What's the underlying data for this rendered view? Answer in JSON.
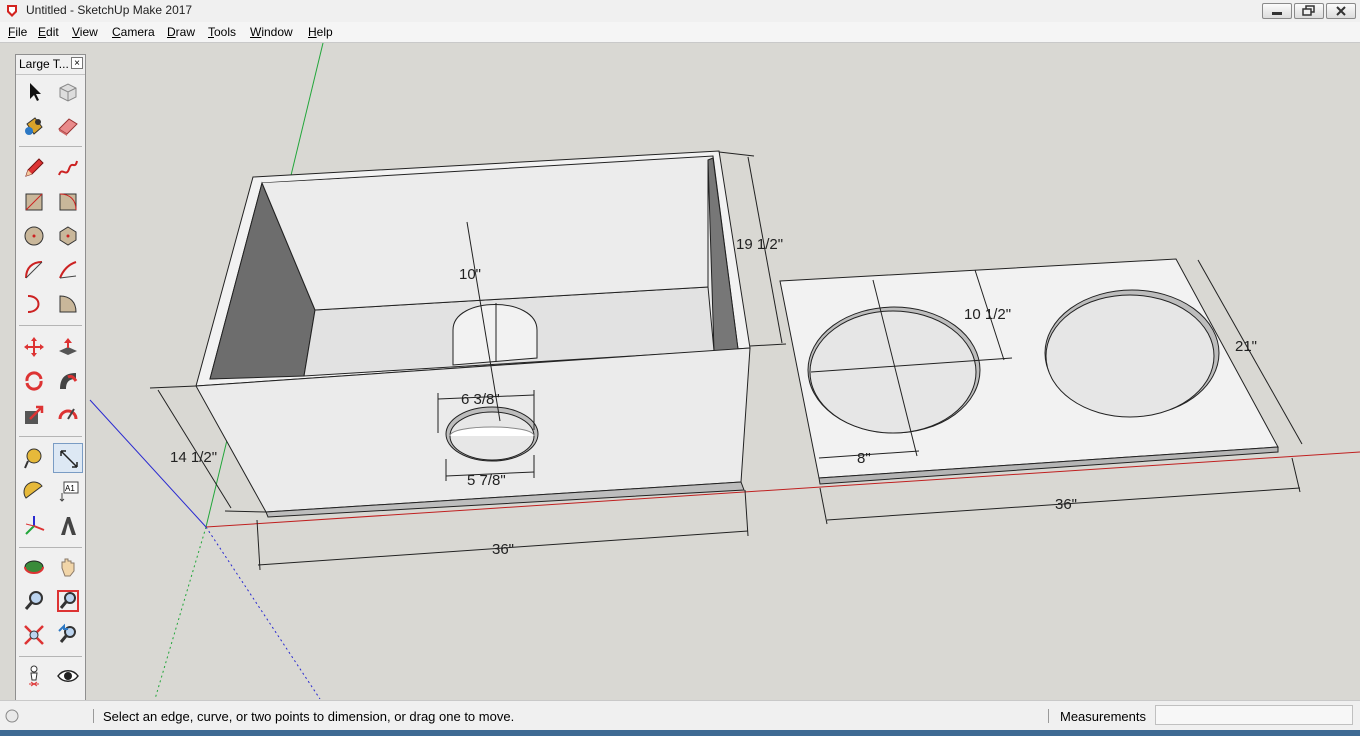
{
  "window": {
    "title": "Untitled - SketchUp Make 2017"
  },
  "menu": [
    "File",
    "Edit",
    "View",
    "Camera",
    "Draw",
    "Tools",
    "Window",
    "Help"
  ],
  "toolbar": {
    "title": "Large T...",
    "close_glyph": "×",
    "text_tool_glyph": "A1"
  },
  "tools": [
    {
      "name": "select-tool",
      "icon": "arrow-icon"
    },
    {
      "name": "make-component-tool",
      "icon": "component-icon"
    },
    {
      "name": "paint-bucket-tool",
      "icon": "paint-bucket-icon"
    },
    {
      "name": "eraser-tool",
      "icon": "eraser-icon"
    },
    {
      "name": "line-tool",
      "icon": "pencil-icon"
    },
    {
      "name": "freehand-tool",
      "icon": "freehand-icon"
    },
    {
      "name": "rectangle-tool",
      "icon": "rectangle-icon"
    },
    {
      "name": "rotated-rectangle-tool",
      "icon": "rotated-rectangle-icon"
    },
    {
      "name": "circle-tool",
      "icon": "circle-icon"
    },
    {
      "name": "polygon-tool",
      "icon": "polygon-icon"
    },
    {
      "name": "arc-tool",
      "icon": "arc-icon"
    },
    {
      "name": "two-point-arc-tool",
      "icon": "two-point-arc-icon"
    },
    {
      "name": "three-point-arc-tool",
      "icon": "three-point-arc-icon"
    },
    {
      "name": "pie-tool",
      "icon": "pie-icon"
    },
    {
      "name": "move-tool",
      "icon": "move-icon"
    },
    {
      "name": "push-pull-tool",
      "icon": "push-pull-icon"
    },
    {
      "name": "rotate-tool",
      "icon": "rotate-icon"
    },
    {
      "name": "follow-me-tool",
      "icon": "follow-me-icon"
    },
    {
      "name": "scale-tool",
      "icon": "scale-icon"
    },
    {
      "name": "offset-tool",
      "icon": "offset-icon"
    },
    {
      "name": "tape-measure-tool",
      "icon": "tape-measure-icon"
    },
    {
      "name": "dimension-tool",
      "icon": "dimension-icon",
      "active": true
    },
    {
      "name": "protractor-tool",
      "icon": "protractor-icon"
    },
    {
      "name": "text-tool",
      "icon": "text-icon"
    },
    {
      "name": "axes-tool",
      "icon": "axes-icon"
    },
    {
      "name": "3d-text-tool",
      "icon": "3d-text-icon"
    },
    {
      "name": "orbit-tool",
      "icon": "orbit-icon"
    },
    {
      "name": "pan-tool",
      "icon": "hand-icon"
    },
    {
      "name": "zoom-tool",
      "icon": "magnifier-icon"
    },
    {
      "name": "zoom-window-tool",
      "icon": "zoom-window-icon"
    },
    {
      "name": "zoom-extents-tool",
      "icon": "zoom-extents-icon"
    },
    {
      "name": "previous-view-tool",
      "icon": "previous-view-icon"
    },
    {
      "name": "position-camera-tool",
      "icon": "position-camera-icon"
    },
    {
      "name": "look-around-tool",
      "icon": "eye-icon"
    },
    {
      "name": "walk-tool",
      "icon": "footprints-icon"
    },
    {
      "name": "section-plane-tool",
      "icon": "section-plane-icon"
    }
  ],
  "dimensions": {
    "box_height": "19 1/2\"",
    "box_depth": "14 1/2\"",
    "box_width": "36\"",
    "port_length": "10\"",
    "port_outer": "6 3/8\"",
    "port_inner": "5 7/8\"",
    "panel_offset": "10 1/2\"",
    "panel_depth": "21\"",
    "panel_width": "36\"",
    "panel_edge": "8\""
  },
  "status": {
    "message": "Select an edge, curve, or two points to dimension, or drag one to move.",
    "measurements_label": "Measurements",
    "measurements_value": ""
  }
}
